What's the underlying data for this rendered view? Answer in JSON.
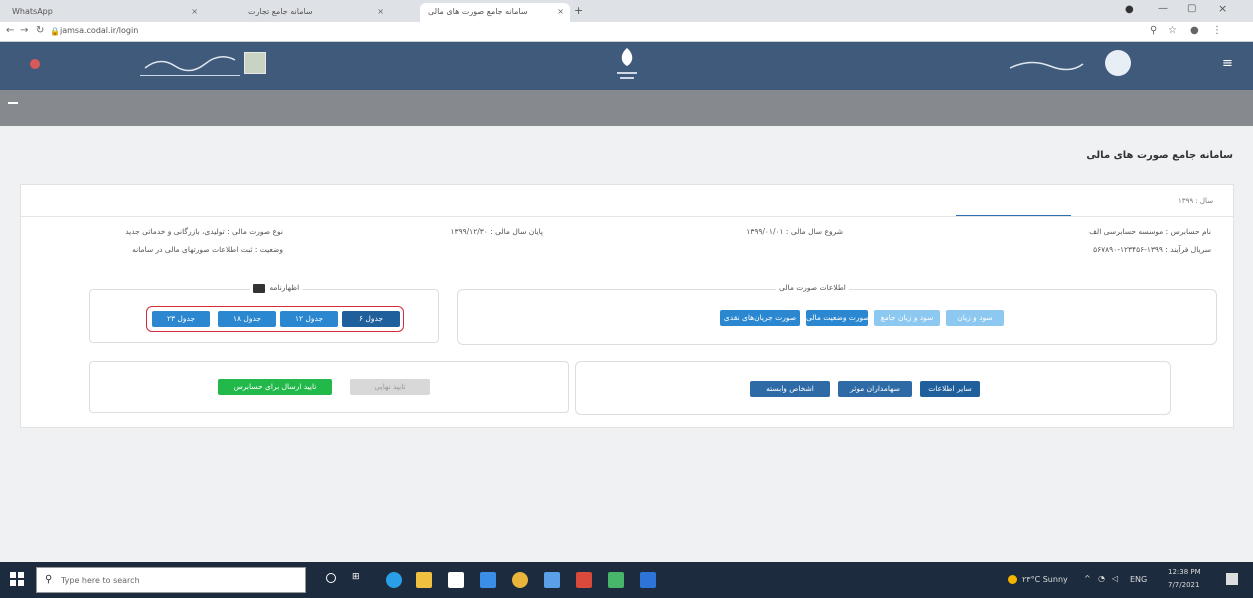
{
  "browser": {
    "tabs": [
      {
        "label": "WhatsApp"
      },
      {
        "label": "سامانه جامع تجارت"
      },
      {
        "label": "سامانه جامع صورت های مالی"
      }
    ],
    "url": "jamsa.codal.ir/login"
  },
  "page": {
    "title": "سامانه جامع صورت های مالی",
    "fiscal_year": "سال : ۱۳۹۹",
    "fields": {
      "reporter": "نام حسابرس : موسسه حسابرسی الف",
      "serial": "سریال فرآیند : ۱۳۹۹-۱۲۳۴۵۶-۵۶۷۸۹۰",
      "fiscal_start": "شروع سال مالی : ۱۳۹۹/۰۱/۰۱",
      "fiscal_end": "پایان سال مالی : ۱۳۹۹/۱۲/۳۰",
      "statement_type": "نوع صورت مالی : تولیدی، بازرگانی و خدماتی جدید",
      "status": "وضعیت : ثبت اطلاعات صورتهای مالی در سامانه"
    },
    "financial_panel": {
      "legend": "اطلاعات صورت مالی",
      "buttons": [
        "سود و زیان",
        "سود و زیان جامع",
        "صورت وضعیت مالی",
        "صورت جریان‌های نقدی"
      ]
    },
    "declaration": {
      "label": "اظهارنامه",
      "buttons": [
        "جدول ۶",
        "جدول ۱۲",
        "جدول ۱۸",
        "جدول ۲۳"
      ]
    },
    "other_panel": {
      "buttons": [
        "سایر اطلاعات",
        "سهامداران موثر",
        "اشخاص وابسته"
      ]
    },
    "actions": {
      "disabled": "تایید نهایی",
      "submit": "تایید ارسال برای حسابرس"
    }
  },
  "taskbar": {
    "search_placeholder": "Type here to search",
    "weather": "۲۳°C Sunny",
    "lang": "ENG",
    "time": "12:38 PM",
    "date": "7/7/2021"
  }
}
